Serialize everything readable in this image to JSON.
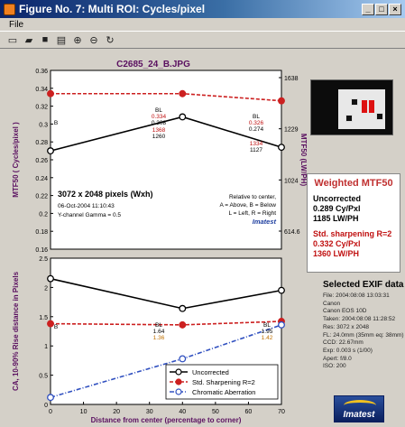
{
  "window": {
    "title": "Figure No. 7: Multi ROI: Cycles/pixel",
    "buttons": [
      "_",
      "□",
      "×"
    ]
  },
  "menu": {
    "items": [
      "File"
    ]
  },
  "toolbar": {
    "icons": [
      "new-file-icon",
      "open-folder-icon",
      "save-icon",
      "print-icon",
      "zoom-in-icon",
      "zoom-out-icon",
      "rotate-icon"
    ]
  },
  "image_title": "C2685_24_B.JPG",
  "annotations": {
    "pixels": "3072 x 2048 pixels (Wxh)",
    "date": "06-Oct-2004 11:10:43",
    "gamma": "Y-channel   Gamma = 0.5",
    "relative": "Relative to center,",
    "above_below": "A = Above, B = Below",
    "left_right": "L = Left, R = Right",
    "brand": "Imatest",
    "top_labels": [
      {
        "text": "B"
      },
      {
        "text": "BL"
      },
      {
        "text": "0.334"
      },
      {
        "text": "0.308"
      },
      {
        "text": "1368"
      },
      {
        "text": "1260"
      },
      {
        "text": "BL"
      },
      {
        "text": "0.326"
      },
      {
        "text": "0.274"
      },
      {
        "text": "1334"
      },
      {
        "text": "1127"
      }
    ],
    "bottom_labels": [
      {
        "text": "B"
      },
      {
        "text": "BL"
      },
      {
        "text": "1.64"
      },
      {
        "text": "1.36"
      },
      {
        "text": "BL"
      },
      {
        "text": "1.95"
      },
      {
        "text": "1.42"
      }
    ]
  },
  "chart_data": [
    {
      "type": "line",
      "xlabel": "",
      "ylabel": "MTF50 ( Cycles/pixel )",
      "ylabel_right": "MTF50 (LW/PH)",
      "x": [
        0,
        40,
        70
      ],
      "xlim": [
        0,
        70
      ],
      "ylim": [
        0.16,
        0.36
      ],
      "yticks": [
        "0.16",
        "0.18",
        "0.2",
        "0.22",
        "0.24",
        "0.26",
        "0.28",
        "0.3",
        "0.32",
        "0.34",
        "0.36"
      ],
      "yticks_right": [
        "1638",
        "1229",
        "1024",
        "614.6"
      ],
      "series": [
        {
          "name": "Uncorrected",
          "values": [
            0.27,
            0.308,
            0.274
          ],
          "color": "#000000"
        },
        {
          "name": "Std. Sharpening R=2",
          "values": [
            0.334,
            0.334,
            0.326
          ],
          "color": "#cc2020"
        }
      ]
    },
    {
      "type": "line",
      "xlabel": "Distance from center (percentage to corner)",
      "ylabel": "CA, 10-90% Rise distance in Pixels",
      "x": [
        0,
        40,
        70
      ],
      "xlim": [
        0,
        70
      ],
      "ylim": [
        0,
        2.5
      ],
      "xticks": [
        "0",
        "10",
        "20",
        "30",
        "40",
        "50",
        "60",
        "70"
      ],
      "yticks": [
        "0",
        "0.5",
        "1",
        "1.5",
        "2",
        "2.5"
      ],
      "series": [
        {
          "name": "Uncorrected",
          "values": [
            2.15,
            1.64,
            1.95
          ],
          "color": "#000000"
        },
        {
          "name": "Std. Sharpening R=2",
          "values": [
            1.38,
            1.36,
            1.42
          ],
          "color": "#cc2020"
        },
        {
          "name": "Chromatic Aberration",
          "values": [
            0.12,
            0.78,
            1.36
          ],
          "color": "#3050c0"
        }
      ]
    }
  ],
  "weighted": {
    "title": "Weighted MTF50",
    "uncorrected_label": "Uncorrected",
    "uncorrected_cyp": "0.289 Cy/Pxl",
    "uncorrected_lwph": "1185 LW/PH",
    "sharp_label": "Std. sharpening R=2",
    "sharp_cyp": "0.332 Cy/Pxl",
    "sharp_lwph": "1360 LW/PH"
  },
  "exif": {
    "title": "Selected EXIF data",
    "lines": [
      "File: 2004:08:08 13:03:31",
      "Canon",
      "Canon EOS 10D",
      "Taken: 2004:08:08 11:28:52",
      "Res: 3072 x 2048",
      "FL: 24.0mm (35mm eq: 38mm)",
      "CCD: 22.67mm",
      "Exp: 0.003 s (1/00)",
      "Apert: f/8.0",
      "ISO: 200"
    ]
  },
  "logo_text": "Imatest",
  "colors": {
    "black": "#000000",
    "red": "#cc2020",
    "blue": "#3050c0",
    "title_purple": "#5a1060"
  }
}
